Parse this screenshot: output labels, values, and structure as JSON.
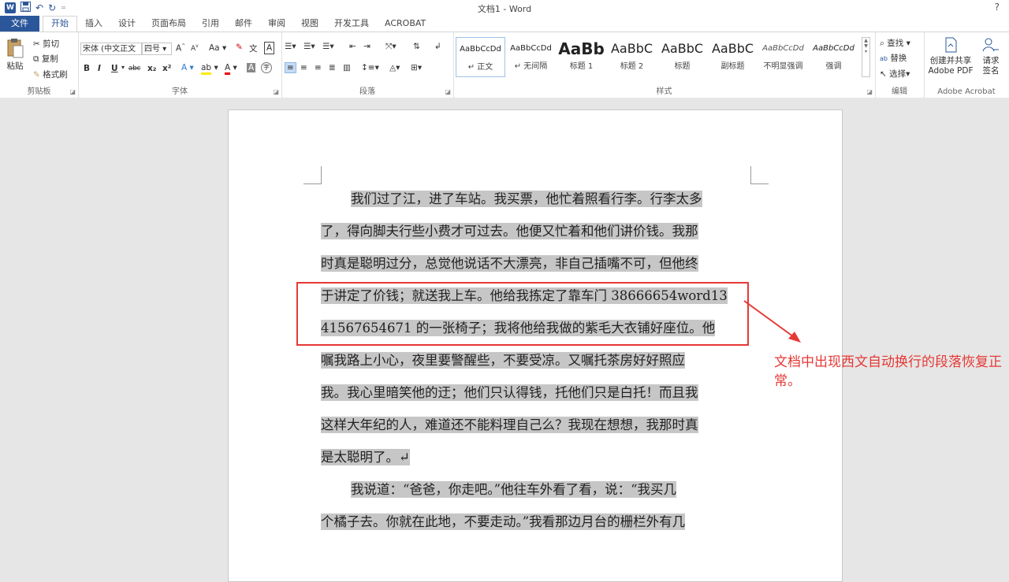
{
  "window": {
    "title": "文档1 - Word",
    "help": "?"
  },
  "qat": {
    "logo": "W",
    "save_icon": "floppy-icon",
    "undo_icon": "undo-icon",
    "redo_icon": "redo-icon",
    "undo": "↶",
    "redo": "↻",
    "more": "="
  },
  "tabs": [
    "文件",
    "开始",
    "插入",
    "设计",
    "页面布局",
    "引用",
    "邮件",
    "审阅",
    "视图",
    "开发工具",
    "ACROBAT"
  ],
  "clipboard": {
    "paste": "粘贴",
    "cut": "剪切",
    "copy": "复制",
    "format_painter": "格式刷",
    "label": "剪贴板"
  },
  "font": {
    "family": "宋体 (中文正文",
    "size": "四号",
    "grow": "A",
    "shrink": "A",
    "case": "Aa",
    "clear": "✎",
    "phonetic": "文",
    "border": "A",
    "bold": "B",
    "italic": "I",
    "underline": "U",
    "strike": "abc",
    "sub": "x₂",
    "sup": "x²",
    "effects": "A",
    "highlight": "ab",
    "color": "A",
    "shade": "A",
    "enclose": "字",
    "label": "字体"
  },
  "paragraph": {
    "label": "段落"
  },
  "styles": {
    "label": "样式",
    "items": [
      {
        "preview": "AaBbCcDd",
        "name": "↵ 正文"
      },
      {
        "preview": "AaBbCcDd",
        "name": "↵ 无间隔"
      },
      {
        "preview": "AaBb",
        "name": "标题 1"
      },
      {
        "preview": "AaBbC",
        "name": "标题 2"
      },
      {
        "preview": "AaBbC",
        "name": "标题"
      },
      {
        "preview": "AaBbC",
        "name": "副标题"
      },
      {
        "preview": "AaBbCcDd",
        "name": "不明显强调"
      },
      {
        "preview": "AaBbCcDd",
        "name": "强调"
      }
    ]
  },
  "editing": {
    "find": "查找",
    "replace": "替换",
    "select": "选择",
    "label": "编辑"
  },
  "acrobat": {
    "create1": "创建并共享",
    "create2": "Adobe PDF",
    "request1": "请求",
    "request2": "签名",
    "label": "Adobe Acrobat"
  },
  "document": {
    "lines": [
      "我们过了江，进了车站。我买票，他忙着照看行李。行李太多",
      "了，得向脚夫行些小费才可过去。他便又忙着和他们讲价钱。我那",
      "时真是聪明过分，总觉他说话不大漂亮，非自己插嘴不可，但他终",
      "于讲定了价钱；就送我上车。他给我拣定了靠车门 38666654word13",
      "41567654671 的一张椅子；我将他给我做的紫毛大衣铺好座位。他",
      "嘱我路上小心，夜里要警醒些，不要受凉。又嘱托茶房好好照应",
      "我。我心里暗笑他的迂；他们只认得钱，托他们只是白托！而且我",
      "这样大年纪的人，难道还不能料理自己么？我现在想想，我那时真",
      "是太聪明了。↵",
      "我说道：“爸爸，你走吧。”他往车外看了看，说：“我买几",
      "个橘子去。你就在此地，不要走动。”我看那边月台的栅栏外有几"
    ]
  },
  "annotation": "文档中出现西文自动换行的段落恢复正常。"
}
